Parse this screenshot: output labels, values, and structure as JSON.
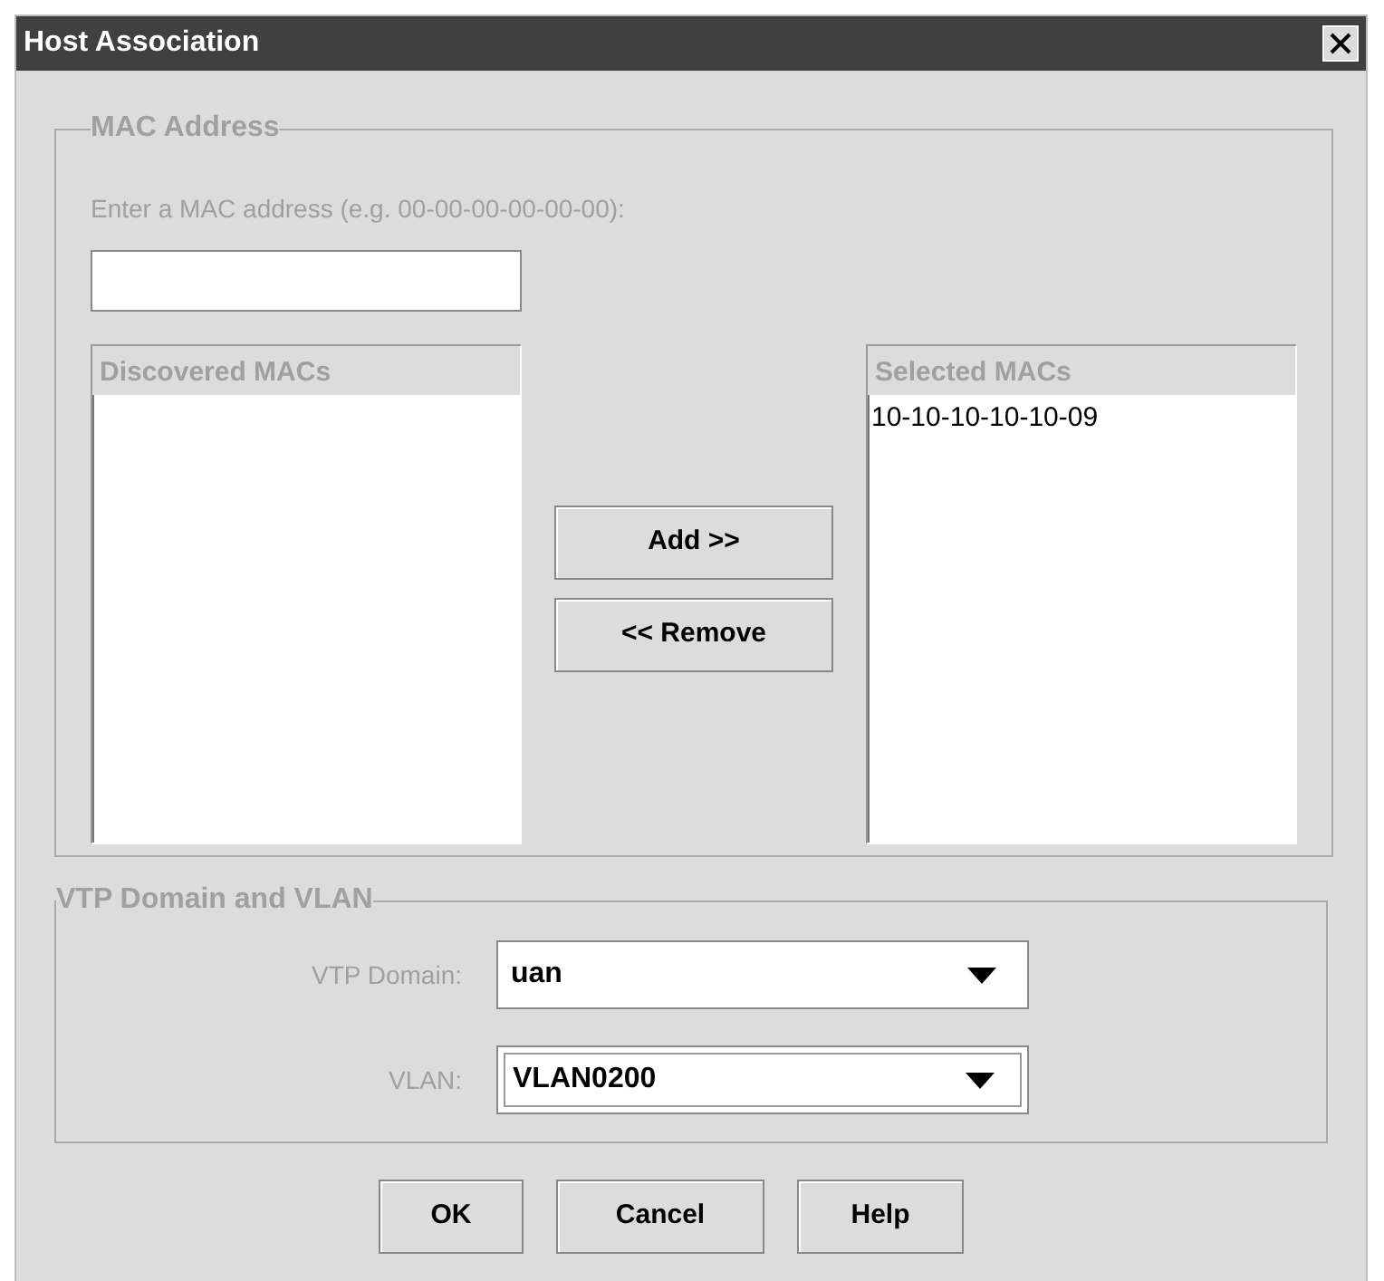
{
  "window": {
    "title": "Host Association"
  },
  "mac_address": {
    "title": "MAC Address",
    "hint": "Enter a MAC address (e.g. 00-00-00-00-00-00):",
    "discovered": {
      "header": "Discovered MACs"
    },
    "selected": {
      "header": "Selected MACs",
      "items": [
        "10-10-10-10-10-09"
      ]
    },
    "transfer_buttons": [
      "Add >>",
      "<< Remove"
    ]
  },
  "vtp": {
    "title": "VTP Domain and VLAN",
    "fields": [
      {
        "label": "VTP Domain:",
        "value": "uan",
        "focused": false
      },
      {
        "label": "VLAN:",
        "value": "VLAN0200",
        "focused": true
      }
    ]
  },
  "buttons": [
    "OK",
    "Cancel",
    "Help"
  ]
}
